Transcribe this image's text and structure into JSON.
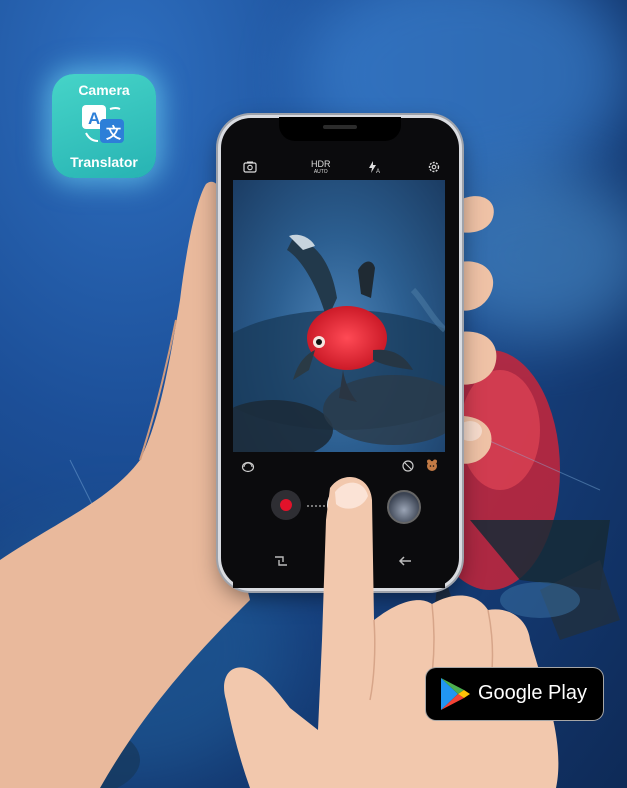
{
  "app_badge": {
    "line1": "Camera",
    "line2": "Translator",
    "icon": "translate-icon",
    "bg_color": "#2fbfbd"
  },
  "camera_toolbar": {
    "flip_icon": "camera-flip-icon",
    "hdr_label": "HDR",
    "hdr_sub": "AUTO",
    "flash_icon": "flash-auto-icon",
    "settings_icon": "gear-icon"
  },
  "camera_controls": {
    "lens_icon": "lens-switch-icon",
    "filter_icon": "filter-icon",
    "sticker_icon": "sticker-icon",
    "record_icon": "record-button",
    "record_color": "#e3122a"
  },
  "nav": {
    "recent_icon": "recents-icon",
    "back_icon": "back-arrow-icon"
  },
  "store_badge": {
    "label": "Google Play",
    "icon": "play-store-icon"
  }
}
